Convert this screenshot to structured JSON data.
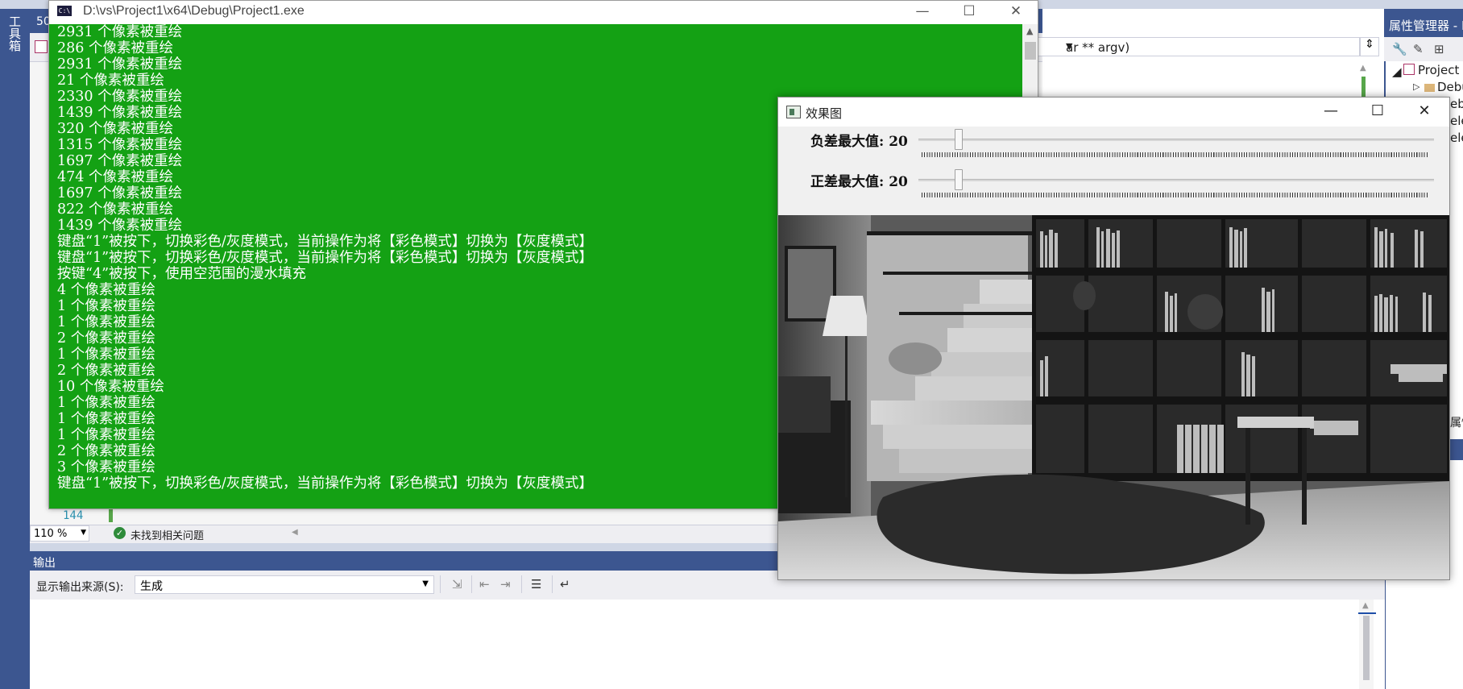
{
  "vs": {
    "toolbox_label": "工具箱",
    "tab_text": "50",
    "func_signature": "ar ** argv)",
    "property_manager": {
      "title": "属性管理器 - P",
      "tree": [
        "Project",
        "Debu",
        "ebu",
        "elea",
        "elea"
      ],
      "side_text": "属性"
    },
    "line_number": "144",
    "zoom": "110 %",
    "issues_text": "未找到相关问题",
    "output": {
      "title": "输出",
      "source_label": "显示输出来源(S):",
      "source_value": "生成"
    }
  },
  "console": {
    "title": "D:\\vs\\Project1\\x64\\Debug\\Project1.exe",
    "background_color": "#14a114",
    "text_color": "#ffffff",
    "lines": [
      "2931 个像素被重绘",
      "286 个像素被重绘",
      "2931 个像素被重绘",
      "21 个像素被重绘",
      "2330 个像素被重绘",
      "1439 个像素被重绘",
      "320 个像素被重绘",
      "1315 个像素被重绘",
      "1697 个像素被重绘",
      "474 个像素被重绘",
      "1697 个像素被重绘",
      "822 个像素被重绘",
      "1439 个像素被重绘",
      "键盘“1”被按下，切换彩色/灰度模式，当前操作为将【彩色模式】切换为【灰度模式】",
      "键盘“1”被按下，切换彩色/灰度模式，当前操作为将【彩色模式】切换为【灰度模式】",
      "按键“4”被按下，使用空范围的漫水填充",
      "4 个像素被重绘",
      "1 个像素被重绘",
      "1 个像素被重绘",
      "2 个像素被重绘",
      "1 个像素被重绘",
      "2 个像素被重绘",
      "10 个像素被重绘",
      "1 个像素被重绘",
      "1 个像素被重绘",
      "1 个像素被重绘",
      "2 个像素被重绘",
      "3 个像素被重绘",
      "键盘“1”被按下，切换彩色/灰度模式，当前操作为将【彩色模式】切换为【灰度模式】"
    ]
  },
  "image_window": {
    "title": "效果图",
    "trackbars": [
      {
        "label": "负差最大值: 20",
        "value": 20,
        "max": 255
      },
      {
        "label": "正差最大值: 20",
        "value": 20,
        "max": 255
      }
    ],
    "image_description_icon": "grayscale-room-photo"
  }
}
